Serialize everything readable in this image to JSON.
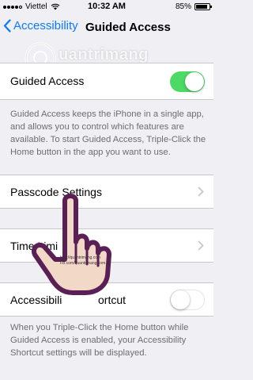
{
  "status_bar": {
    "carrier": "Viettel",
    "time": "10:32 AM",
    "battery": "85%",
    "battery_level": 0.85
  },
  "nav": {
    "back_label": "Accessibility",
    "title": "Guided Access"
  },
  "guided_access": {
    "label": "Guided Access",
    "enabled": true,
    "footer": "Guided Access keeps the iPhone in a single app, and allows you to control which features are available. To start Guided Access, Triple-Click the Home button in the app you want to use."
  },
  "passcode_settings": {
    "label": "Passcode Settings"
  },
  "time_limits": {
    "label": "Time Limi"
  },
  "accessibility_shortcut": {
    "label": "Accessibili",
    "label_tail": "ortcut",
    "enabled": false,
    "footer": "When you Triple-Click the Home button while Guided Access is enabled, your Accessibility Shortcut settings will be displayed."
  },
  "watermark": {
    "brand": "uantrimang",
    "url1": "http://quantrimang.com",
    "url2": "FB.com/quantrimang.com.vn"
  },
  "colors": {
    "accent": "#0a7aff",
    "toggle_on": "#4cd964",
    "background": "#efeff4"
  }
}
